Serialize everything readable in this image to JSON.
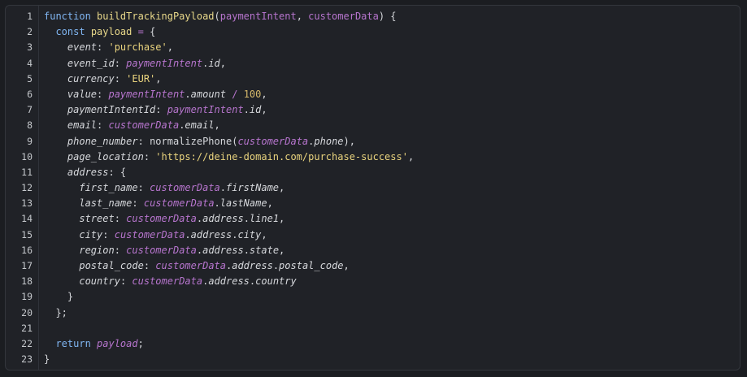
{
  "code": {
    "lines": [
      {
        "n": "1",
        "tokens": [
          [
            "kw",
            "function "
          ],
          [
            "fn",
            "buildTrackingPayload"
          ],
          [
            "punc",
            "("
          ],
          [
            "param",
            "paymentIntent"
          ],
          [
            "punc",
            ", "
          ],
          [
            "param",
            "customerData"
          ],
          [
            "punc",
            ") {"
          ]
        ]
      },
      {
        "n": "2",
        "tokens": [
          [
            "plain",
            "  "
          ],
          [
            "kw",
            "const "
          ],
          [
            "fn",
            "payload"
          ],
          [
            "op",
            " = "
          ],
          [
            "punc",
            "{"
          ]
        ]
      },
      {
        "n": "3",
        "tokens": [
          [
            "plain",
            "    "
          ],
          [
            "prop",
            "event"
          ],
          [
            "punc",
            ": "
          ],
          [
            "str",
            "'purchase'"
          ],
          [
            "punc",
            ","
          ]
        ]
      },
      {
        "n": "4",
        "tokens": [
          [
            "plain",
            "    "
          ],
          [
            "prop",
            "event_id"
          ],
          [
            "punc",
            ": "
          ],
          [
            "var",
            "paymentIntent"
          ],
          [
            "punc",
            "."
          ],
          [
            "prop",
            "id"
          ],
          [
            "punc",
            ","
          ]
        ]
      },
      {
        "n": "5",
        "tokens": [
          [
            "plain",
            "    "
          ],
          [
            "prop",
            "currency"
          ],
          [
            "punc",
            ": "
          ],
          [
            "str",
            "'EUR'"
          ],
          [
            "punc",
            ","
          ]
        ]
      },
      {
        "n": "6",
        "tokens": [
          [
            "plain",
            "    "
          ],
          [
            "prop",
            "value"
          ],
          [
            "punc",
            ": "
          ],
          [
            "var",
            "paymentIntent"
          ],
          [
            "punc",
            "."
          ],
          [
            "prop",
            "amount"
          ],
          [
            "op",
            " / "
          ],
          [
            "num",
            "100"
          ],
          [
            "punc",
            ","
          ]
        ]
      },
      {
        "n": "7",
        "tokens": [
          [
            "plain",
            "    "
          ],
          [
            "prop",
            "paymentIntentId"
          ],
          [
            "punc",
            ": "
          ],
          [
            "var",
            "paymentIntent"
          ],
          [
            "punc",
            "."
          ],
          [
            "prop",
            "id"
          ],
          [
            "punc",
            ","
          ]
        ]
      },
      {
        "n": "8",
        "tokens": [
          [
            "plain",
            "    "
          ],
          [
            "prop",
            "email"
          ],
          [
            "punc",
            ": "
          ],
          [
            "var",
            "customerData"
          ],
          [
            "punc",
            "."
          ],
          [
            "prop",
            "email"
          ],
          [
            "punc",
            ","
          ]
        ]
      },
      {
        "n": "9",
        "tokens": [
          [
            "plain",
            "    "
          ],
          [
            "prop",
            "phone_number"
          ],
          [
            "punc",
            ": "
          ],
          [
            "call",
            "normalizePhone"
          ],
          [
            "punc",
            "("
          ],
          [
            "var",
            "customerData"
          ],
          [
            "punc",
            "."
          ],
          [
            "prop",
            "phone"
          ],
          [
            "punc",
            "),"
          ]
        ]
      },
      {
        "n": "10",
        "tokens": [
          [
            "plain",
            "    "
          ],
          [
            "prop",
            "page_location"
          ],
          [
            "punc",
            ": "
          ],
          [
            "str",
            "'https://deine-domain.com/purchase-success'"
          ],
          [
            "punc",
            ","
          ]
        ]
      },
      {
        "n": "11",
        "tokens": [
          [
            "plain",
            "    "
          ],
          [
            "prop",
            "address"
          ],
          [
            "punc",
            ": {"
          ]
        ]
      },
      {
        "n": "12",
        "tokens": [
          [
            "plain",
            "      "
          ],
          [
            "prop",
            "first_name"
          ],
          [
            "punc",
            ": "
          ],
          [
            "var",
            "customerData"
          ],
          [
            "punc",
            "."
          ],
          [
            "prop",
            "firstName"
          ],
          [
            "punc",
            ","
          ]
        ]
      },
      {
        "n": "13",
        "tokens": [
          [
            "plain",
            "      "
          ],
          [
            "prop",
            "last_name"
          ],
          [
            "punc",
            ": "
          ],
          [
            "var",
            "customerData"
          ],
          [
            "punc",
            "."
          ],
          [
            "prop",
            "lastName"
          ],
          [
            "punc",
            ","
          ]
        ]
      },
      {
        "n": "14",
        "tokens": [
          [
            "plain",
            "      "
          ],
          [
            "prop",
            "street"
          ],
          [
            "punc",
            ": "
          ],
          [
            "var",
            "customerData"
          ],
          [
            "punc",
            "."
          ],
          [
            "prop",
            "address"
          ],
          [
            "punc",
            "."
          ],
          [
            "prop",
            "line1"
          ],
          [
            "punc",
            ","
          ]
        ]
      },
      {
        "n": "15",
        "tokens": [
          [
            "plain",
            "      "
          ],
          [
            "prop",
            "city"
          ],
          [
            "punc",
            ": "
          ],
          [
            "var",
            "customerData"
          ],
          [
            "punc",
            "."
          ],
          [
            "prop",
            "address"
          ],
          [
            "punc",
            "."
          ],
          [
            "prop",
            "city"
          ],
          [
            "punc",
            ","
          ]
        ]
      },
      {
        "n": "16",
        "tokens": [
          [
            "plain",
            "      "
          ],
          [
            "prop",
            "region"
          ],
          [
            "punc",
            ": "
          ],
          [
            "var",
            "customerData"
          ],
          [
            "punc",
            "."
          ],
          [
            "prop",
            "address"
          ],
          [
            "punc",
            "."
          ],
          [
            "prop",
            "state"
          ],
          [
            "punc",
            ","
          ]
        ]
      },
      {
        "n": "17",
        "tokens": [
          [
            "plain",
            "      "
          ],
          [
            "prop",
            "postal_code"
          ],
          [
            "punc",
            ": "
          ],
          [
            "var",
            "customerData"
          ],
          [
            "punc",
            "."
          ],
          [
            "prop",
            "address"
          ],
          [
            "punc",
            "."
          ],
          [
            "prop",
            "postal_code"
          ],
          [
            "punc",
            ","
          ]
        ]
      },
      {
        "n": "18",
        "tokens": [
          [
            "plain",
            "      "
          ],
          [
            "prop",
            "country"
          ],
          [
            "punc",
            ": "
          ],
          [
            "var",
            "customerData"
          ],
          [
            "punc",
            "."
          ],
          [
            "prop",
            "address"
          ],
          [
            "punc",
            "."
          ],
          [
            "prop",
            "country"
          ]
        ]
      },
      {
        "n": "19",
        "tokens": [
          [
            "plain",
            "    "
          ],
          [
            "punc",
            "}"
          ]
        ]
      },
      {
        "n": "20",
        "tokens": [
          [
            "plain",
            "  "
          ],
          [
            "punc",
            "};"
          ]
        ]
      },
      {
        "n": "21",
        "tokens": []
      },
      {
        "n": "22",
        "tokens": [
          [
            "plain",
            "  "
          ],
          [
            "kw",
            "return "
          ],
          [
            "var",
            "payload"
          ],
          [
            "punc",
            ";"
          ]
        ]
      },
      {
        "n": "23",
        "tokens": [
          [
            "punc",
            "}"
          ]
        ]
      }
    ]
  }
}
